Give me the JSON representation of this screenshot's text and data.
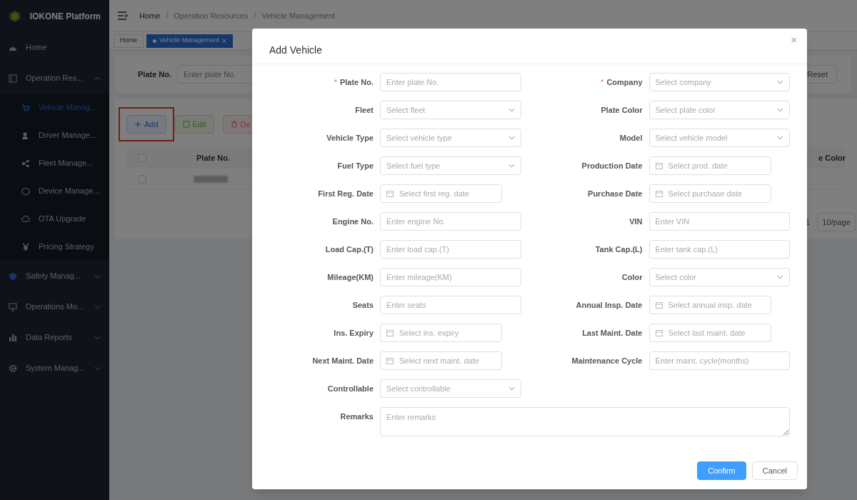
{
  "sidebar": {
    "brand": "IOKONE Platform",
    "items": [
      {
        "label": "Home"
      },
      {
        "label": "Operation Res...",
        "expanded": true,
        "children": [
          {
            "label": "Vehicle Manag...",
            "selected": true
          },
          {
            "label": "Driver Manage...",
            "selected": false
          },
          {
            "label": "Fleet Manage...",
            "selected": false
          },
          {
            "label": "Device Manage...",
            "selected": false
          },
          {
            "label": "OTA Upgrade",
            "selected": false
          },
          {
            "label": "Pricing Strategy",
            "selected": false
          }
        ]
      },
      {
        "label": "Safety Manag...",
        "expanded": false
      },
      {
        "label": "Operations Mo...",
        "expanded": false
      },
      {
        "label": "Data Reports",
        "expanded": false
      },
      {
        "label": "System Manag...",
        "expanded": false
      }
    ]
  },
  "breadcrumb": [
    {
      "kind": "link",
      "text": "Home"
    },
    {
      "kind": "separator",
      "text": "/"
    },
    {
      "kind": "link",
      "text": "Operation Resources"
    },
    {
      "kind": "separator",
      "text": "/"
    },
    {
      "kind": "link",
      "text": "Vehicle Management"
    }
  ],
  "tabs": [
    {
      "label": "Home",
      "selected": false
    },
    {
      "label": "Vehicle Management",
      "selected": true,
      "closable": true
    }
  ],
  "filter": {
    "label": "Plate No.",
    "placeholder": "Enter plate No.",
    "reset": "Reset"
  },
  "toolbar": [
    {
      "kind": "add",
      "label": "Add",
      "highlighted": true
    },
    {
      "kind": "edit",
      "label": "Edit",
      "highlighted": false
    },
    {
      "kind": "delete",
      "label": "De",
      "highlighted": false
    }
  ],
  "table": {
    "columns": [
      "Plate No.",
      "e Color"
    ],
    "select_all_checked": false,
    "rows": [
      {
        "checked": false
      }
    ]
  },
  "pagination": {
    "page": "1",
    "size": "10/page"
  },
  "dialog": {
    "title": "Add Vehicle",
    "close": "×",
    "fields": [
      {
        "kind": "text",
        "label": "Plate No.",
        "required_mark": "*",
        "placeholder": "Enter plate No."
      },
      {
        "kind": "select",
        "label": "Company",
        "required_mark": "*",
        "placeholder": "Select company"
      },
      {
        "kind": "select",
        "label": "Fleet",
        "placeholder": "Select fleet"
      },
      {
        "kind": "select",
        "label": "Plate Color",
        "placeholder": "Select plate color"
      },
      {
        "kind": "select",
        "label": "Vehicle Type",
        "placeholder": "Select vehicle type"
      },
      {
        "kind": "select",
        "label": "Model",
        "placeholder": "Select vehicle model"
      },
      {
        "kind": "select",
        "label": "Fuel Type",
        "placeholder": "Select fuel type"
      },
      {
        "kind": "date",
        "label": "Production Date",
        "placeholder": "Select prod. date"
      },
      {
        "kind": "date",
        "label": "First Reg. Date",
        "placeholder": "Select first reg. date"
      },
      {
        "kind": "date",
        "label": "Purchase Date",
        "placeholder": "Select purchase date"
      },
      {
        "kind": "text",
        "label": "Engine No.",
        "placeholder": "Enter engine No."
      },
      {
        "kind": "text",
        "label": "VIN",
        "placeholder": "Enter VIN"
      },
      {
        "kind": "text",
        "label": "Load Cap.(T)",
        "placeholder": "Enter load cap.(T)"
      },
      {
        "kind": "text",
        "label": "Tank Cap.(L)",
        "placeholder": "Enter tank cap.(L)"
      },
      {
        "kind": "text",
        "label": "Mileage(KM)",
        "placeholder": "Enter mileage(KM)"
      },
      {
        "kind": "select",
        "label": "Color",
        "placeholder": "Select color"
      },
      {
        "kind": "text",
        "label": "Seats",
        "placeholder": "Enter seats"
      },
      {
        "kind": "date",
        "label": "Annual Insp. Date",
        "placeholder": "Select annual insp. date"
      },
      {
        "kind": "date",
        "label": "Ins. Expiry",
        "placeholder": "Select ins. expiry"
      },
      {
        "kind": "date",
        "label": "Last Maint. Date",
        "placeholder": "Select last maint. date"
      },
      {
        "kind": "date",
        "label": "Next Maint. Date",
        "placeholder": "Select next maint. date"
      },
      {
        "kind": "text",
        "label": "Maintenance Cycle",
        "placeholder": "Enter maint. cycle(months)"
      },
      {
        "kind": "select",
        "label": "Controllable",
        "placeholder": "Select controllable"
      },
      {
        "kind": "textarea",
        "label": "Remarks",
        "placeholder": "Enter remarks"
      }
    ],
    "buttons": [
      {
        "kind": "primary",
        "label": "Confirm"
      },
      {
        "kind": "default",
        "label": "Cancel"
      }
    ]
  }
}
